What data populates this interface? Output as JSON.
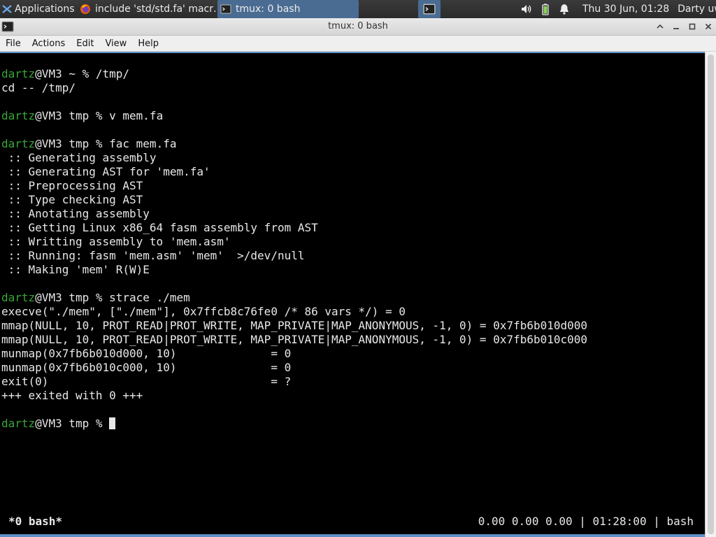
{
  "panel": {
    "applications_label": "Applications",
    "tasks": [
      {
        "label": "include 'std/std.fa' macr…",
        "icon": "firefox-icon"
      },
      {
        "label": "tmux: 0 bash",
        "icon": "terminal-icon"
      }
    ],
    "clock": "Thu 30 Jun, 01:28",
    "user": "Darty uwu"
  },
  "window": {
    "title": "tmux: 0 bash"
  },
  "menubar": {
    "items": [
      "File",
      "Actions",
      "Edit",
      "View",
      "Help"
    ]
  },
  "terminal": {
    "prompt_user": "dartz",
    "lines": [
      {
        "user": "dartz",
        "rest": "@VM3 ~ % /tmp/"
      },
      {
        "text": "cd -- /tmp/"
      },
      {
        "text": ""
      },
      {
        "user": "dartz",
        "rest": "@VM3 tmp % v mem.fa"
      },
      {
        "text": ""
      },
      {
        "user": "dartz",
        "rest": "@VM3 tmp % fac mem.fa"
      },
      {
        "text": " :: Generating assembly"
      },
      {
        "text": " :: Generating AST for 'mem.fa'"
      },
      {
        "text": " :: Preprocessing AST"
      },
      {
        "text": " :: Type checking AST"
      },
      {
        "text": " :: Anotating assembly"
      },
      {
        "text": " :: Getting Linux x86_64 fasm assembly from AST"
      },
      {
        "text": " :: Writting assembly to 'mem.asm'"
      },
      {
        "text": " :: Running: fasm 'mem.asm' 'mem'  >/dev/null"
      },
      {
        "text": " :: Making 'mem' R(W)E"
      },
      {
        "text": ""
      },
      {
        "user": "dartz",
        "rest": "@VM3 tmp % strace ./mem"
      },
      {
        "text": "execve(\"./mem\", [\"./mem\"], 0x7ffcb8c76fe0 /* 86 vars */) = 0"
      },
      {
        "text": "mmap(NULL, 10, PROT_READ|PROT_WRITE, MAP_PRIVATE|MAP_ANONYMOUS, -1, 0) = 0x7fb6b010d000"
      },
      {
        "text": "mmap(NULL, 10, PROT_READ|PROT_WRITE, MAP_PRIVATE|MAP_ANONYMOUS, -1, 0) = 0x7fb6b010c000"
      },
      {
        "text": "munmap(0x7fb6b010d000, 10)              = 0"
      },
      {
        "text": "munmap(0x7fb6b010c000, 10)              = 0"
      },
      {
        "text": "exit(0)                                 = ?"
      },
      {
        "text": "+++ exited with 0 +++"
      },
      {
        "text": ""
      },
      {
        "user": "dartz",
        "rest": "@VM3 tmp % ",
        "cursor": true
      }
    ],
    "status_left": "*0 bash*",
    "status_right": "0.00 0.00 0.00 | 01:28:00 | bash"
  },
  "colors": {
    "prompt_user": "#3aa53a",
    "accent": "#4a6c93",
    "terminal_bg": "#000000",
    "terminal_fg": "#e8e8e8"
  }
}
